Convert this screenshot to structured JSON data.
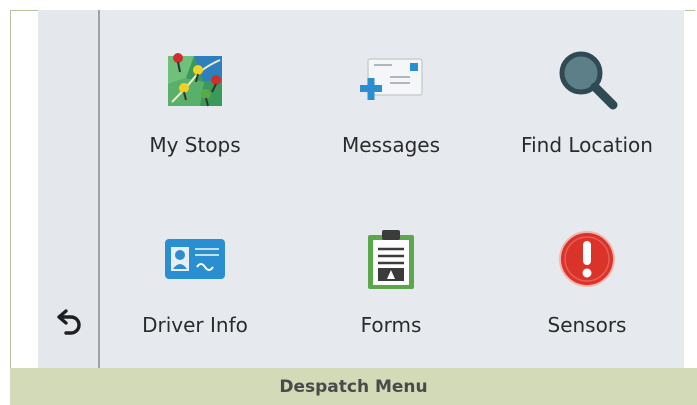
{
  "menu": {
    "items": [
      {
        "label": "My Stops",
        "icon": "map-pins-icon"
      },
      {
        "label": "Messages",
        "icon": "envelope-plus-icon"
      },
      {
        "label": "Find Location",
        "icon": "magnifier-icon"
      },
      {
        "label": "Driver Info",
        "icon": "id-card-icon"
      },
      {
        "label": "Forms",
        "icon": "clipboard-icon"
      },
      {
        "label": "Sensors",
        "icon": "alert-icon"
      }
    ],
    "back_icon": "back-arrow-icon"
  },
  "caption": "Despatch Menu",
  "colors": {
    "screen_bg": "#e6eaee",
    "footer_bg": "#d2dab8",
    "accent_blue": "#2a8fd0",
    "accent_red": "#d9332a",
    "accent_green": "#5aa84a"
  }
}
